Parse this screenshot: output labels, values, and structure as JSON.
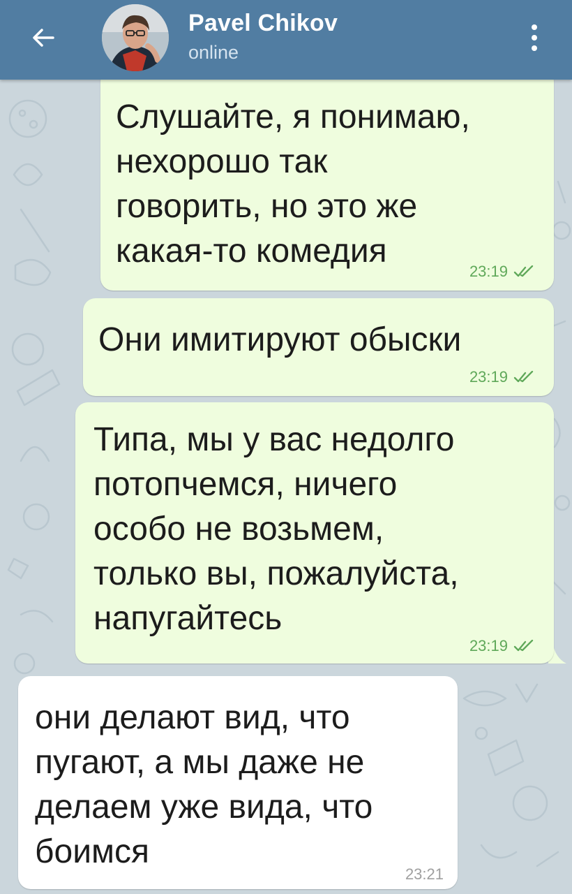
{
  "header": {
    "contact_name": "Pavel Chikov",
    "status": "online",
    "back_icon": "arrow-left-icon",
    "menu_icon": "more-vertical-icon",
    "background_color": "#517da2"
  },
  "messages": [
    {
      "direction": "outgoing",
      "text": "Слушайте, я понимаю,\nнехорошо так\nговорить, но это же\nкакая-то комедия",
      "time": "23:19",
      "read": true
    },
    {
      "direction": "outgoing",
      "text": "Они имитируют обыски",
      "time": "23:19",
      "read": true
    },
    {
      "direction": "outgoing",
      "text": "Типа, мы у вас недолго\nпотопчемся, ничего\nособо не возьмем,\nтолько вы, пожалуйста,\nнапугайтесь",
      "time": "23:19",
      "read": true
    },
    {
      "direction": "incoming",
      "text": "они делают вид, что\nпугают, а мы даже не\nделаем уже вида, что\nбоимся",
      "time": "23:21"
    }
  ],
  "colors": {
    "outgoing_bubble": "#effdde",
    "incoming_bubble": "#ffffff",
    "read_check": "#5fa859",
    "wallpaper": "#cbd6dc"
  }
}
